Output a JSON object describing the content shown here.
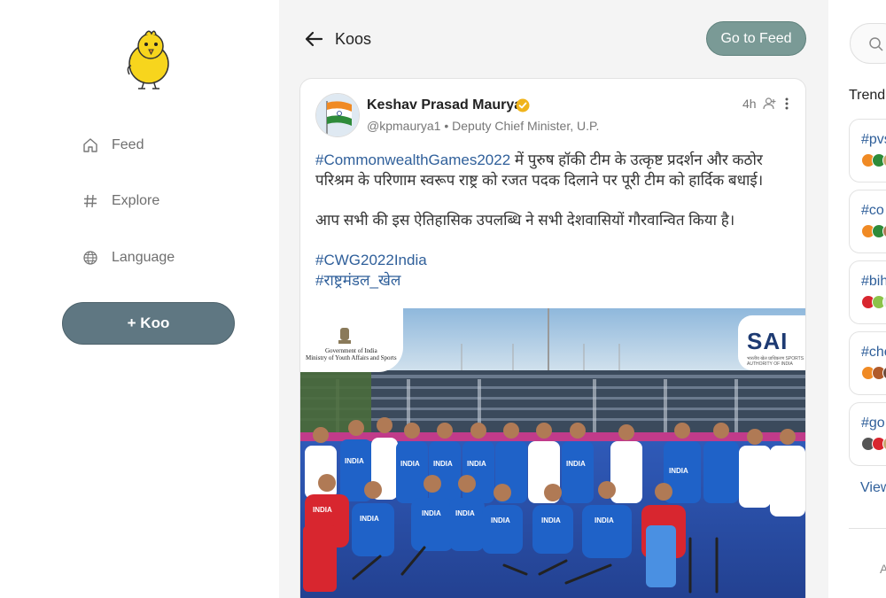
{
  "sidebar": {
    "logo": "koo-chick-logo",
    "nav": [
      {
        "label": "Feed",
        "icon": "home-icon"
      },
      {
        "label": "Explore",
        "icon": "hashtag-icon"
      },
      {
        "label": "Language",
        "icon": "globe-icon"
      }
    ],
    "koo_button_label": "+ Koo"
  },
  "main": {
    "back_icon": "arrow-left-icon",
    "title": "Koos",
    "go_to_feed_label": "Go to Feed",
    "post": {
      "author_name": "Keshav Prasad Maurya",
      "handle": "@kpmaurya1",
      "separator": "•",
      "role": "Deputy Chief Minister, U.P.",
      "time": "4h",
      "hashtag1": "#CommonwealthGames2022",
      "text1": " में पुरुष हॉकी टीम के उत्कृष्ट प्रदर्शन और कठोर परिश्रम के परिणाम स्वरूप राष्ट्र को रजत पदक दिलाने पर पूरी टीम को हार्दिक बधाई।",
      "text2": "आप सभी की इस ऐतिहासिक उपलब्धि ने सभी देशवासियों गौरवान्वित किया है।",
      "hashtag2": "#CWG2022India",
      "hashtag3": "#राष्ट्रमंडल_खेल",
      "image": {
        "gov_text_line1": "Government of India",
        "gov_text_line2": "Ministry of Youth Affairs and Sports",
        "sai_text": "SAI",
        "sai_subtext": "भारतीय खेल प्राधिकरण SPORTS AUTHORITY OF INDIA",
        "jersey_text": "INDIA"
      }
    }
  },
  "right": {
    "search_icon": "search-icon",
    "trending_title": "Trend",
    "trends": [
      {
        "tag": "#pvs"
      },
      {
        "tag": "#co"
      },
      {
        "tag": "#bih"
      },
      {
        "tag": "#che"
      },
      {
        "tag": "#go"
      }
    ],
    "view_more": "View",
    "footer_char": "A"
  },
  "colors": {
    "koo_button": "#5f7782",
    "go_to_feed": "#7a9a96",
    "hashtag": "#2f5f9a",
    "main_bg": "#f4f4f4",
    "jersey_blue": "#1f62c8",
    "pitch_blue": "#2a4fb0"
  }
}
